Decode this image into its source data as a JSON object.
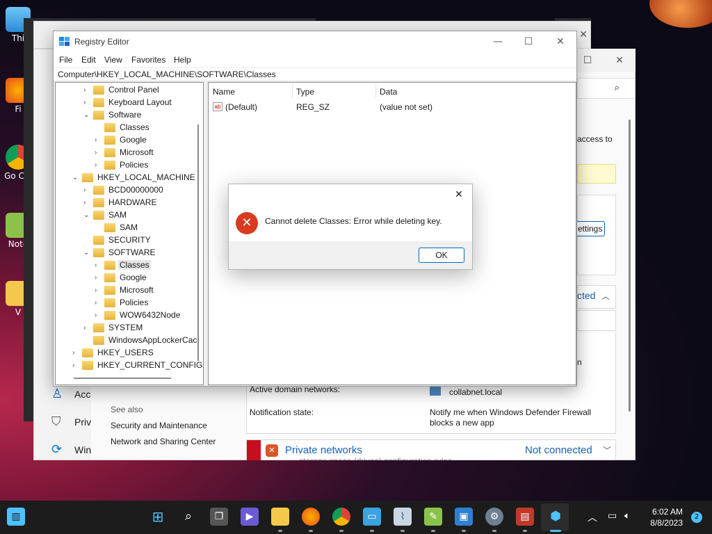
{
  "desktop": {
    "icons": [
      {
        "label": "Thi",
        "name": "this-pc"
      },
      {
        "label": "Fi",
        "name": "firefox"
      },
      {
        "label": "Go Chi",
        "name": "google-chrome"
      },
      {
        "label": "Note",
        "name": "notepad-plus"
      },
      {
        "label": "V",
        "name": "folder"
      }
    ]
  },
  "firewall": {
    "access_to": "access to",
    "settings_btn": "ettings",
    "connected": "cted",
    "line_n": "n",
    "sidebar": [
      "Acc",
      "Priv",
      "Win"
    ],
    "see_also": "See also",
    "link_security": "Security and Maintenance",
    "link_network": "Network and Sharing Center",
    "active_domain_label": "Active domain networks:",
    "active_domain_value": "collabnet.local",
    "notification_label": "Notification state:",
    "notification_value_1": "Notify me when Windows Defender Firewall",
    "notification_value_2": "blocks a new app",
    "private_networks": "Private networks",
    "private_status": "Not connected",
    "cut_text": "storage space (drives) configuration rules"
  },
  "regedit": {
    "title": "Registry Editor",
    "menu": [
      "File",
      "Edit",
      "View",
      "Favorites",
      "Help"
    ],
    "address": "Computer\\HKEY_LOCAL_MACHINE\\SOFTWARE\\Classes",
    "tree": [
      {
        "label": "Control Panel",
        "exp": "›"
      },
      {
        "label": "Keyboard Layout",
        "exp": "›"
      },
      {
        "label": "Software",
        "exp": "⌄"
      },
      {
        "label": "Classes",
        "exp": ""
      },
      {
        "label": "Google",
        "exp": "›"
      },
      {
        "label": "Microsoft",
        "exp": "›"
      },
      {
        "label": "Policies",
        "exp": "›"
      },
      {
        "label": "HKEY_LOCAL_MACHINE",
        "exp": "⌄"
      },
      {
        "label": "BCD00000000",
        "exp": "›"
      },
      {
        "label": "HARDWARE",
        "exp": "›"
      },
      {
        "label": "SAM",
        "exp": "⌄"
      },
      {
        "label": "SAM",
        "exp": ""
      },
      {
        "label": "SECURITY",
        "exp": ""
      },
      {
        "label": "SOFTWARE",
        "exp": "⌄"
      },
      {
        "label": "Classes",
        "exp": "›"
      },
      {
        "label": "Google",
        "exp": "›"
      },
      {
        "label": "Microsoft",
        "exp": "›"
      },
      {
        "label": "Policies",
        "exp": "›"
      },
      {
        "label": "WOW6432Node",
        "exp": "›"
      },
      {
        "label": "SYSTEM",
        "exp": "›"
      },
      {
        "label": "WindowsAppLockerCac",
        "exp": ""
      },
      {
        "label": "HKEY_USERS",
        "exp": "›"
      },
      {
        "label": "HKEY_CURRENT_CONFIG",
        "exp": "›"
      }
    ],
    "columns": [
      "Name",
      "Type",
      "Data"
    ],
    "rows": [
      {
        "name": "(Default)",
        "type": "REG_SZ",
        "data": "(value not set)"
      }
    ]
  },
  "dialog": {
    "message": "Cannot delete Classes:  Error while deleting key.",
    "ok": "OK"
  },
  "taskbar": {
    "time": "6:02 AM",
    "date": "8/8/2023",
    "notifications": "2"
  }
}
